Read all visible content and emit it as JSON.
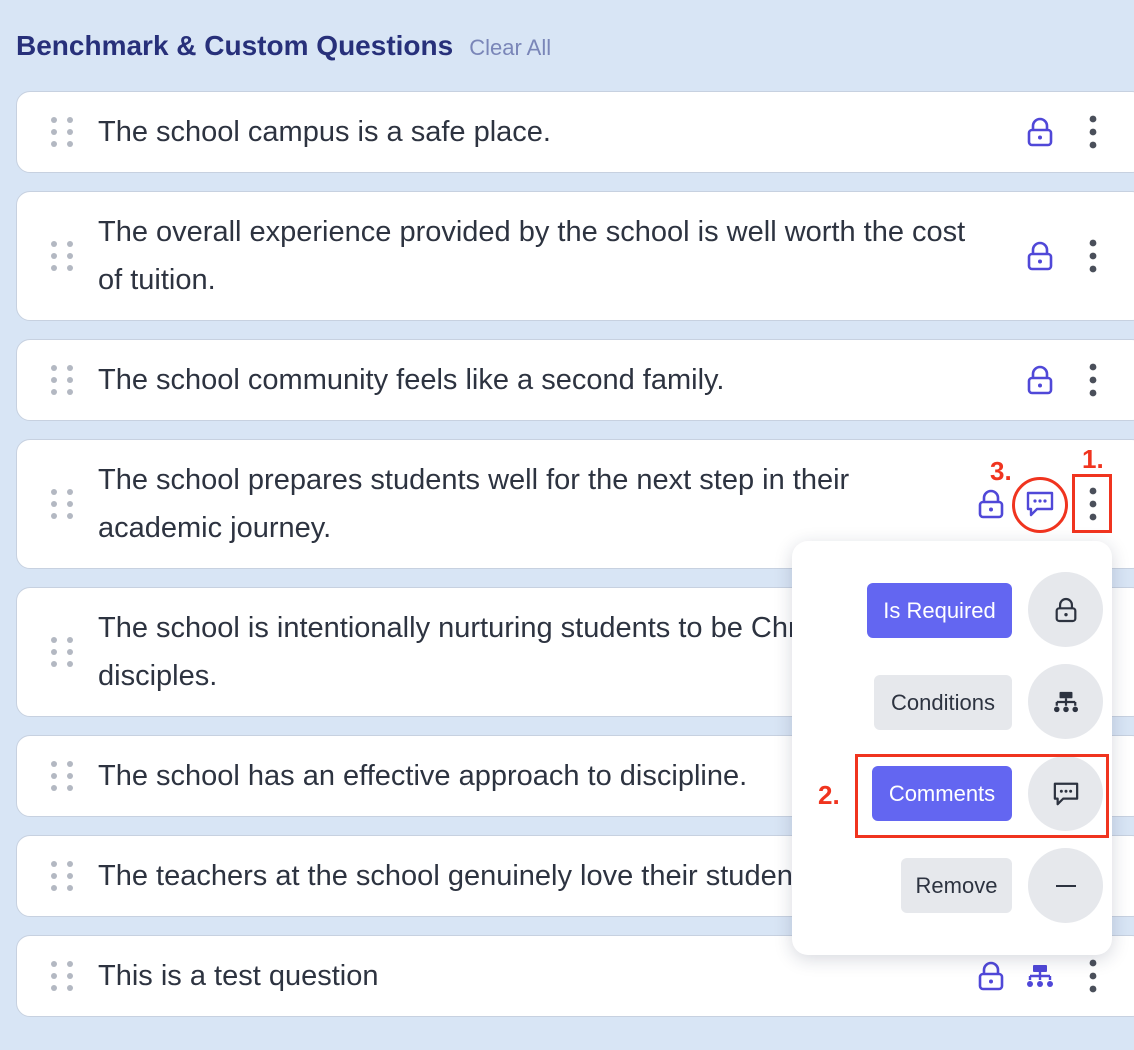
{
  "header": {
    "title": "Benchmark & Custom Questions",
    "clear_label": "Clear All"
  },
  "questions": [
    {
      "text": "The school campus is a safe place."
    },
    {
      "text": "The overall experience provided by the school is well worth the cost of tuition."
    },
    {
      "text": "The school community feels like a second family."
    },
    {
      "text": "The school prepares students well for the next step in their academic journey."
    },
    {
      "text": "The school is intentionally nurturing students to be Christian disciples."
    },
    {
      "text": "The school has an effective approach to discipline."
    },
    {
      "text": "The teachers at the school genuinely love their students."
    },
    {
      "text": "This is a test question"
    }
  ],
  "menu": {
    "is_required": "Is Required",
    "conditions": "Conditions",
    "comments": "Comments",
    "remove": "Remove"
  },
  "annotations": {
    "a1": "1.",
    "a2": "2.",
    "a3": "3."
  },
  "colors": {
    "accent": "#6366f1",
    "icon": "#5048d8",
    "annotation": "#f0341f"
  }
}
